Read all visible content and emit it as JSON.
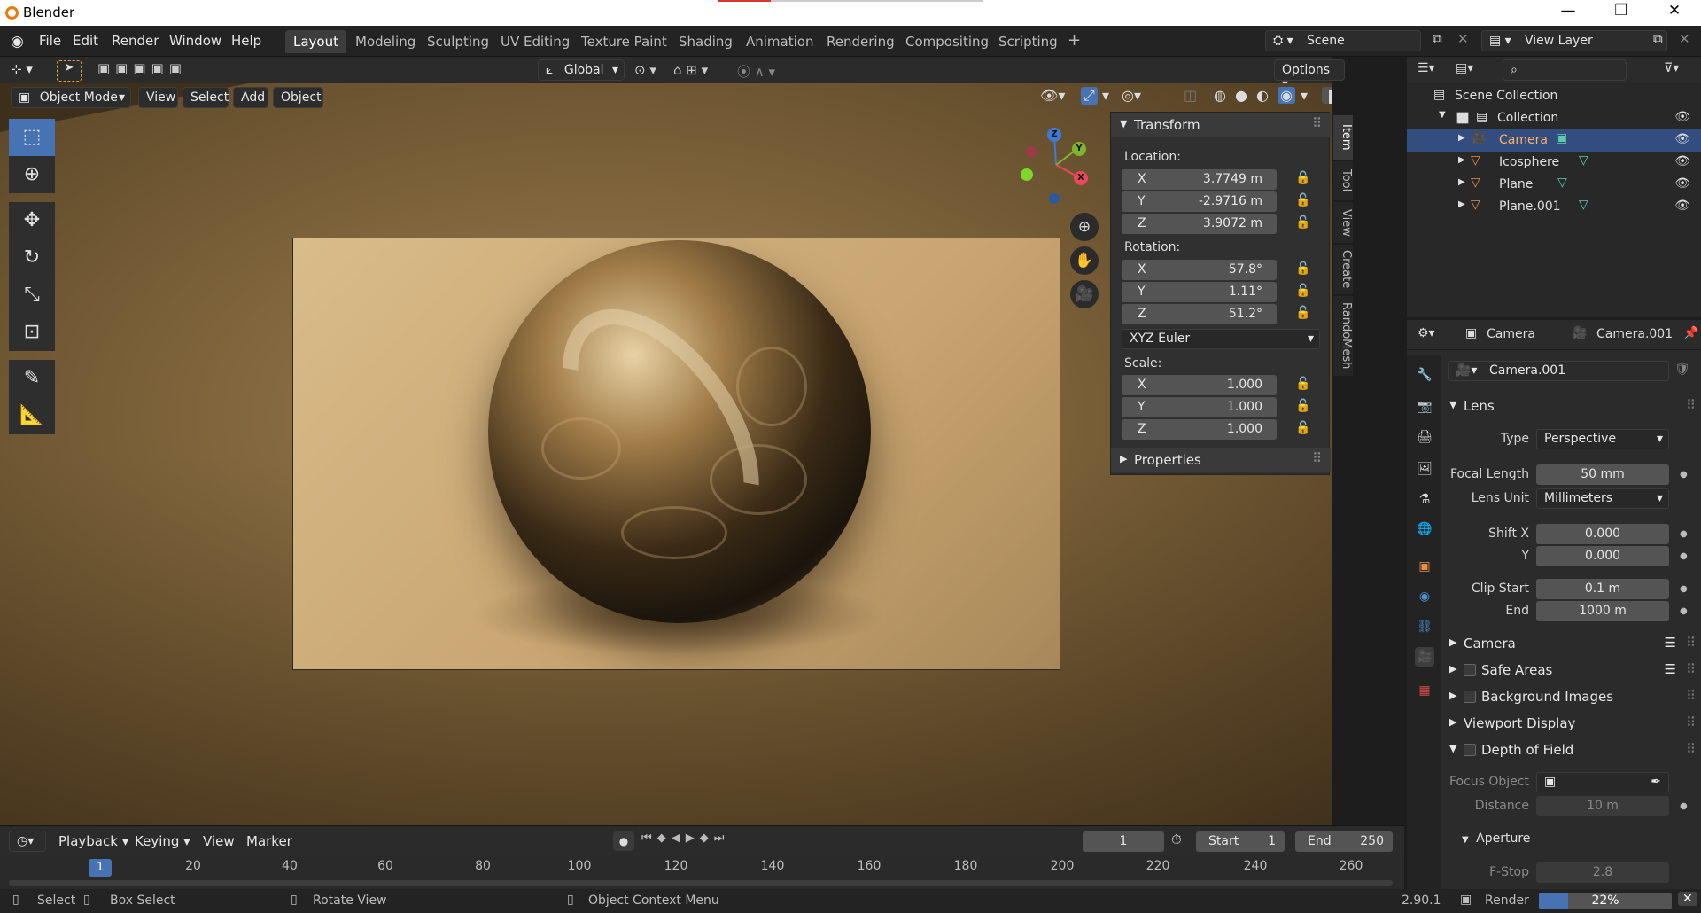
{
  "app_title": "Blender",
  "menus": [
    "File",
    "Edit",
    "Render",
    "Window",
    "Help"
  ],
  "workspaces": [
    "Layout",
    "Modeling",
    "Sculpting",
    "UV Editing",
    "Texture Paint",
    "Shading",
    "Animation",
    "Rendering",
    "Compositing",
    "Scripting"
  ],
  "active_workspace": "Layout",
  "scene_name": "Scene",
  "view_layer": "View Layer",
  "viewport": {
    "transform_orientation": "Global",
    "options_label": "Options",
    "mode": "Object Mode",
    "header_menus": [
      "View",
      "Select",
      "Add",
      "Object"
    ]
  },
  "gizmo": {
    "x": "X",
    "y": "Y",
    "z": "Z"
  },
  "npanel": {
    "transform_title": "Transform",
    "location_label": "Location:",
    "location": {
      "x": "3.7749 m",
      "y": "-2.9716 m",
      "z": "3.9072 m"
    },
    "rotation_label": "Rotation:",
    "rotation": {
      "x": "57.8°",
      "y": "1.11°",
      "z": "51.2°"
    },
    "rotation_mode": "XYZ Euler",
    "scale_label": "Scale:",
    "scale": {
      "x": "1.000",
      "y": "1.000",
      "z": "1.000"
    },
    "properties_title": "Properties",
    "axis": {
      "x": "X",
      "y": "Y",
      "z": "Z"
    },
    "tabs": [
      "Item",
      "Tool",
      "View",
      "Create",
      "RandoMesh"
    ]
  },
  "outliner": {
    "root": "Scene Collection",
    "collection": "Collection",
    "objects": [
      "Camera",
      "Icosphere",
      "Plane",
      "Plane.001"
    ],
    "selected": "Camera"
  },
  "properties": {
    "object_name": "Camera",
    "data_name": "Camera.001",
    "datablock": "Camera.001",
    "lens_section": "Lens",
    "type_label": "Type",
    "type_value": "Perspective",
    "focal_label": "Focal Length",
    "focal_value": "50 mm",
    "lens_unit_label": "Lens Unit",
    "lens_unit_value": "Millimeters",
    "shift_x_label": "Shift X",
    "shift_x_value": "0.000",
    "shift_y_label": "Y",
    "shift_y_value": "0.000",
    "clip_start_label": "Clip Start",
    "clip_start_value": "0.1 m",
    "clip_end_label": "End",
    "clip_end_value": "1000 m",
    "sections": [
      "Camera",
      "Safe Areas",
      "Background Images",
      "Viewport Display",
      "Depth of Field"
    ],
    "focus_object_label": "Focus Object",
    "distance_label": "Distance",
    "distance_value": "10 m",
    "aperture_label": "Aperture",
    "fstop_label": "F-Stop",
    "fstop_value": "2.8"
  },
  "timeline": {
    "menus": [
      "Playback",
      "Keying",
      "View",
      "Marker"
    ],
    "current_frame": "1",
    "start_label": "Start",
    "start_value": "1",
    "end_label": "End",
    "end_value": "250",
    "ticks": [
      "20",
      "40",
      "60",
      "80",
      "100",
      "120",
      "140",
      "160",
      "180",
      "200",
      "220",
      "240",
      "260"
    ]
  },
  "statusbar": {
    "select": "Select",
    "box_select": "Box Select",
    "rotate_view": "Rotate View",
    "context_menu": "Object Context Menu",
    "version": "2.90.1",
    "render_label": "Render",
    "render_progress": "22%",
    "render_progress_fraction": 0.22
  },
  "colors": {
    "accent": "#4772b3",
    "selection": "#334d80",
    "x_axis": "#e8485a",
    "y_axis": "#7fb52c",
    "z_axis": "#3d7cd6"
  }
}
